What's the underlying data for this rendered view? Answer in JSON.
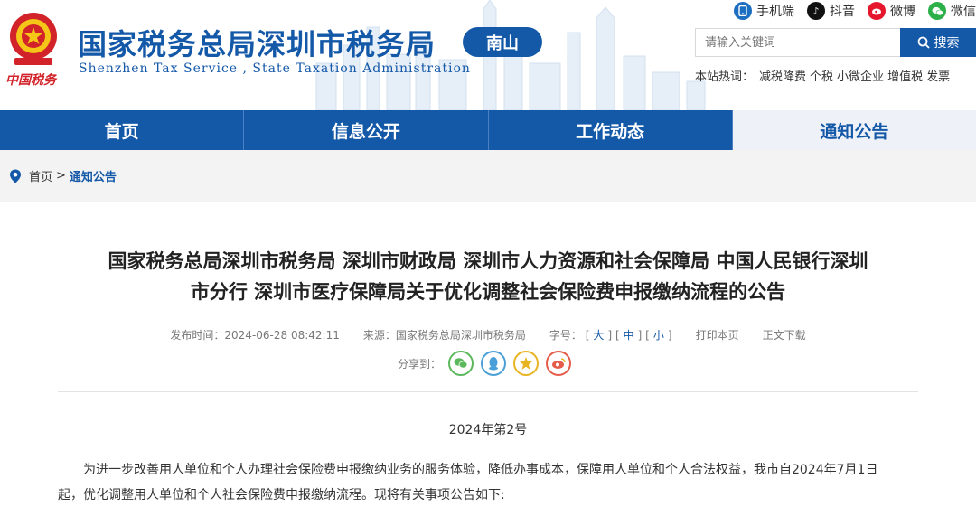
{
  "header": {
    "brand_calligraphy": "中国税务",
    "site_title": "国家税务总局深圳市税务局",
    "site_subtitle": "Shenzhen Tax Service , State Taxation Administration",
    "region": "南山",
    "brand_color": "#1458a8"
  },
  "social": [
    {
      "label": "手机端",
      "icon": "mobile-icon"
    },
    {
      "label": "抖音",
      "icon": "douyin-icon"
    },
    {
      "label": "微博",
      "icon": "weibo-icon"
    },
    {
      "label": "微信",
      "icon": "wechat-icon"
    }
  ],
  "search": {
    "placeholder": "请输入关键词",
    "button": "搜索"
  },
  "hotwords": {
    "label": "本站热词：",
    "items": [
      "减税降费",
      "个税",
      "小微企业",
      "增值税",
      "发票"
    ]
  },
  "nav": {
    "items": [
      "首页",
      "信息公开",
      "工作动态",
      "通知公告"
    ],
    "active": "通知公告"
  },
  "breadcrumb": {
    "home": "首页",
    "separator": ">",
    "current": "通知公告"
  },
  "article": {
    "title_line1": "国家税务总局深圳市税务局 深圳市财政局 深圳市人力资源和社会保障局 中国人民银行深圳",
    "title_line2": "市分行 深圳市医疗保障局关于优化调整社会保险费申报缴纳流程的公告",
    "meta": {
      "publish_label": "发布时间：",
      "publish_time": "2024-06-28 08:42:11",
      "source_label": "来源：",
      "source": "国家税务总局深圳市税务局",
      "font_label": "字号：",
      "size_large": "大",
      "size_medium": "中",
      "size_small": "小",
      "print": "打印本页",
      "download": "正文下载"
    },
    "share_label": "分享到：",
    "doc_number": "2024年第2号",
    "paragraph1": "为进一步改善用人单位和个人办理社会保险费申报缴纳业务的服务体验，降低办事成本，保障用人单位和个人合法权益，我市自2024年7月1日起，优化调整用人单位和个人社会保险费申报缴纳流程。现将有关事项公告如下:"
  }
}
